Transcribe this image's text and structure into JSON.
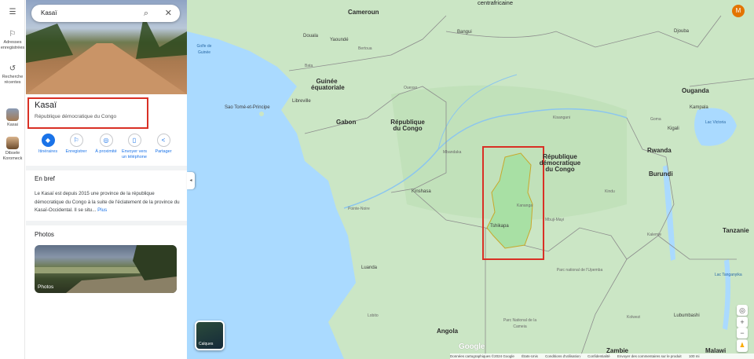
{
  "rail": {
    "items": [
      {
        "label": "",
        "icon": "menu-icon"
      },
      {
        "label": "Adresses enregistrées",
        "icon": "bookmark-icon"
      },
      {
        "label": "Recherche récentes",
        "icon": "history-icon"
      },
      {
        "label": "Kasai",
        "icon": "kasai-thumbnail"
      },
      {
        "label": "Dibsele Koromeck",
        "icon": "place-thumbnail"
      }
    ]
  },
  "search": {
    "value": "Kasaï"
  },
  "place": {
    "title": "Kasaï",
    "subtitle": "République démocratique du Congo"
  },
  "actions": [
    {
      "label": "Itinéraires",
      "icon": "directions-icon"
    },
    {
      "label": "Enregistrer",
      "icon": "bookmark-icon"
    },
    {
      "label": "À proximité",
      "icon": "nearby-icon"
    },
    {
      "label": "Envoyer vers un téléphone",
      "icon": "phone-icon"
    },
    {
      "label": "Partager",
      "icon": "share-icon"
    }
  ],
  "overview": {
    "heading": "En bref",
    "text": "Le Kasaï est depuis 2015 une province de la république démocratique du Congo à la suite de l'éclatement de la province du Kasaï-Occidental. Il se situ...",
    "more": "Plus"
  },
  "photos": {
    "heading": "Photos",
    "label": "Photos"
  },
  "map": {
    "avatar": "M",
    "layers_label": "Calques",
    "google": "Google",
    "countries": [
      "Cameroun",
      "centrafricaine",
      "Guinée équatoriale",
      "Gabon",
      "République du Congo",
      "République démocratique du Congo",
      "Ouganda",
      "Rwanda",
      "Burundi",
      "Tanzanie",
      "Angola",
      "Zambie",
      "Malawi"
    ],
    "cities": [
      "Yaoundé",
      "Douala",
      "Libreville",
      "Kinshasa",
      "Luanda",
      "Bangui",
      "Kampala",
      "Kigali",
      "Lubumbashi",
      "Tshikapa",
      "Kananga",
      "Mbuji-Mayi",
      "Goma",
      "Djouba",
      "Bertoua",
      "Mbandaka",
      "Kisangani",
      "Kindu",
      "Kalemie",
      "Kolwezi",
      "Lobito",
      "Ouesso",
      "Pointe-Noire",
      "Bata"
    ],
    "islands": [
      "Sao Tomé-et-Principe"
    ],
    "water": [
      "Golfe de Guinée",
      "Lac Victoria",
      "Lac Tanganyika"
    ],
    "parks": [
      "Parc National de la Cameia",
      "Parc national de l'Upemba"
    ],
    "footer": [
      "Données cartographiques ©2024 Google",
      "États-Unis",
      "Conditions d'utilisation",
      "Confidentialité",
      "Envoyer des commentaires sur le produit",
      "100 mi"
    ]
  },
  "colors": {
    "accent": "#1a73e8",
    "highlight": "#d93025",
    "land": "#cbe6c5",
    "water": "#aadaff"
  }
}
